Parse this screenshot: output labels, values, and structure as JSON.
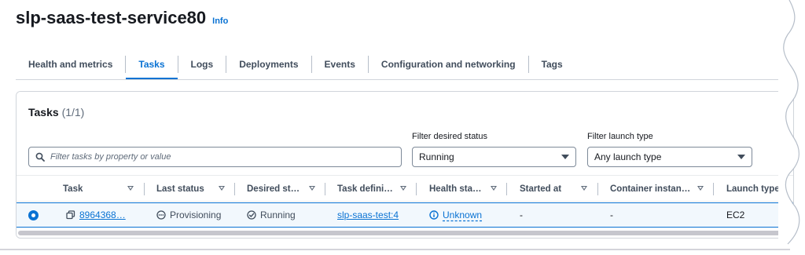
{
  "header": {
    "title": "slp-saas-test-service80",
    "info_label": "Info"
  },
  "tabs": [
    {
      "label": "Health and metrics",
      "active": false
    },
    {
      "label": "Tasks",
      "active": true
    },
    {
      "label": "Logs",
      "active": false
    },
    {
      "label": "Deployments",
      "active": false
    },
    {
      "label": "Events",
      "active": false
    },
    {
      "label": "Configuration and networking",
      "active": false
    },
    {
      "label": "Tags",
      "active": false
    }
  ],
  "tasks_panel": {
    "title": "Tasks",
    "count": "(1/1)",
    "search_placeholder": "Filter tasks by property or value",
    "filter_desired_status": {
      "label": "Filter desired status",
      "value": "Running"
    },
    "filter_launch_type": {
      "label": "Filter launch type",
      "value": "Any launch type"
    },
    "columns": [
      "Task",
      "Last status",
      "Desired st…",
      "Task defini…",
      "Health sta…",
      "Started at",
      "Container instan…",
      "Launch type"
    ],
    "row": {
      "task": "8964368…",
      "last_status": "Provisioning",
      "desired_status": "Running",
      "task_definition": "slp-saas-test:4",
      "health_status": "Unknown",
      "started_at": "-",
      "container_instance": "-",
      "launch_type": "EC2"
    }
  },
  "colors": {
    "accent": "#0972d3",
    "text": "#16191f",
    "selected_row_bg": "#f2f8fd"
  },
  "icons": [
    "info-link",
    "search-icon",
    "caret-down-icon",
    "sort-icon",
    "radio-selected-icon",
    "copy-icon",
    "clock-status-icon",
    "check-circle-icon",
    "info-circle-icon"
  ]
}
